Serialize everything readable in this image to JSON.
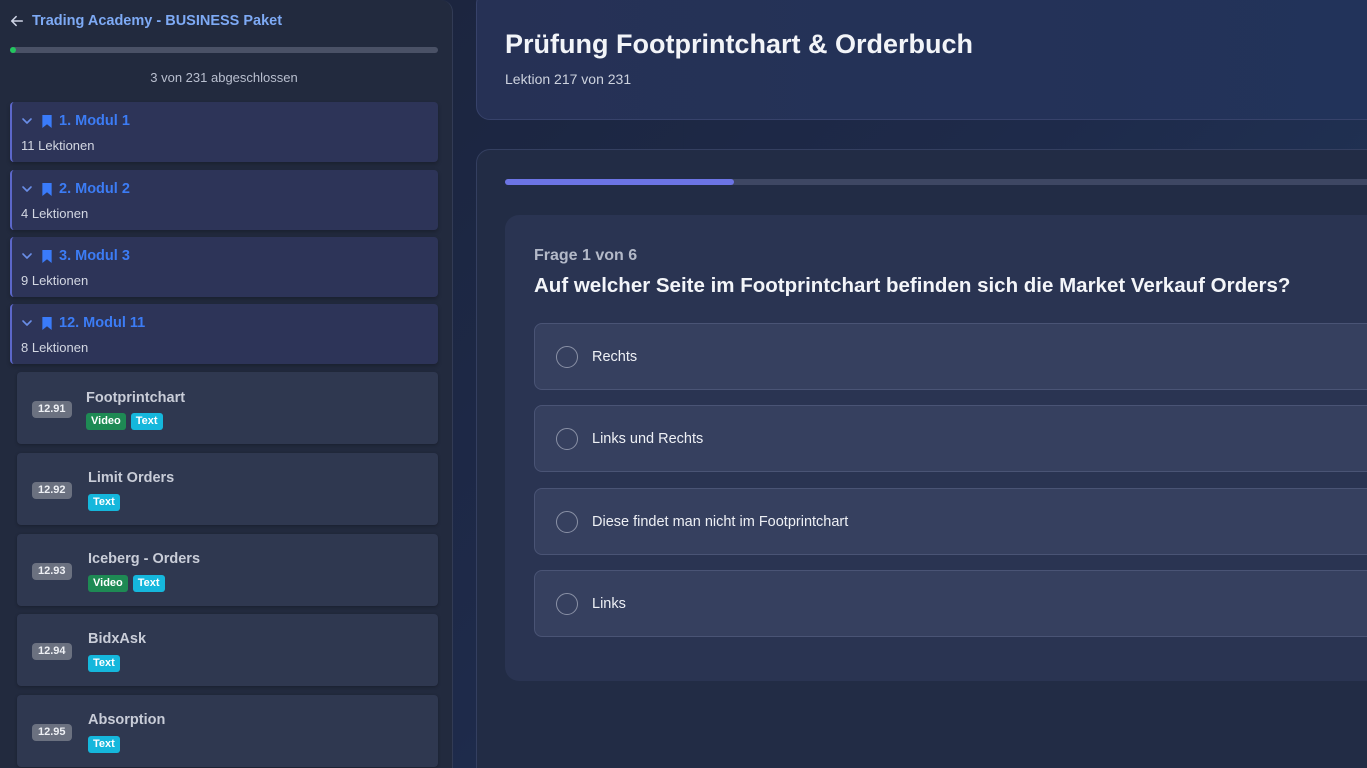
{
  "sidebar": {
    "title": "Trading Academy - BUSINESS Paket",
    "progress_fraction": 0.013,
    "progress_text": "3 von 231 abgeschlossen",
    "modules": [
      {
        "title": "1. Modul 1",
        "lessons": "11 Lektionen"
      },
      {
        "title": "2. Modul 2",
        "lessons": "4 Lektionen"
      },
      {
        "title": "3. Modul 3",
        "lessons": "9 Lektionen"
      },
      {
        "title": "12. Modul 11",
        "lessons": "8 Lektionen"
      }
    ],
    "lessons": [
      {
        "number": "12.91",
        "title": "Footprintchart",
        "tags": [
          "Video",
          "Text"
        ]
      },
      {
        "number": "12.92",
        "title": "Limit Orders",
        "tags": [
          "Text"
        ]
      },
      {
        "number": "12.93",
        "title": "Iceberg - Orders",
        "tags": [
          "Video",
          "Text"
        ]
      },
      {
        "number": "12.94",
        "title": "BidxAsk",
        "tags": [
          "Text"
        ]
      },
      {
        "number": "12.95",
        "title": "Absorption",
        "tags": [
          "Text"
        ]
      }
    ]
  },
  "main": {
    "title": "Prüfung Footprintchart & Orderbuch",
    "lesson_count": "Lektion 217 von 231"
  },
  "quiz": {
    "progress_fraction": 0.26,
    "counter": "Frage 1 von 6",
    "question": "Auf welcher Seite im Footprintchart befinden sich die Market Verkauf Orders?",
    "answers": [
      "Rechts",
      "Links und Rechts",
      "Diese findet man nicht im Footprintchart",
      "Links"
    ]
  },
  "colors": {
    "accent": "#6c74e4",
    "module_title": "#3c7cf5",
    "video_tag": "#1e8a54",
    "text_tag": "#15b7dc",
    "progress_green": "#22c55e"
  },
  "icons": {
    "back": "arrow-left-icon",
    "module_toggle": "chevron-down-icon",
    "module_marker": "bookmark-icon",
    "answer_select": "radio-icon"
  }
}
